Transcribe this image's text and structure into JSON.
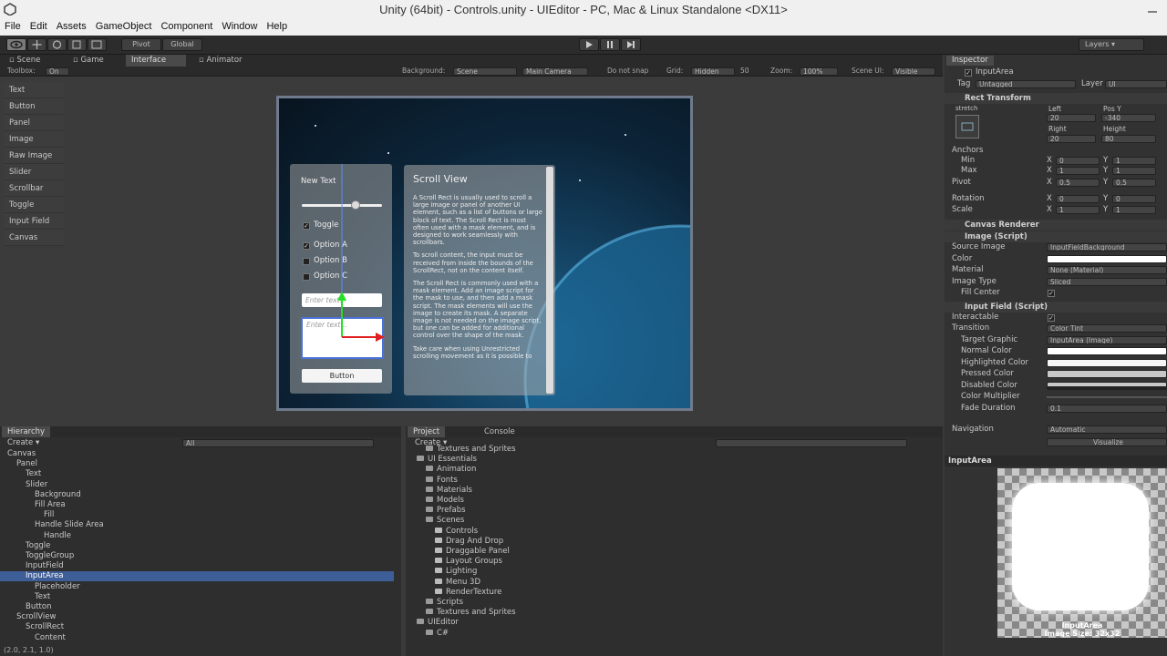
{
  "window": {
    "title": "Unity (64bit) - Controls.unity - UIEditor - PC, Mac & Linux Standalone <DX11>"
  },
  "menu": [
    "File",
    "Edit",
    "Assets",
    "GameObject",
    "Component",
    "Window",
    "Help"
  ],
  "toolbar": {
    "pivot": "Pivot",
    "global": "Global",
    "layers": "Layers"
  },
  "scene_tabs": [
    "Scene",
    "Game",
    "Interface",
    "Animator"
  ],
  "scene_opts": {
    "toolbox_label": "Toolbox:",
    "toolbox_value": "On",
    "background_label": "Background:",
    "background_value": "Scene",
    "camera": "Main Camera",
    "snap": "Do not snap",
    "grid_label": "Grid:",
    "grid_value": "Hidden",
    "grid_num": "50",
    "zoom_label": "Zoom:",
    "zoom_value": "100%",
    "sceneui_label": "Scene UI:",
    "sceneui_value": "Visible"
  },
  "palette": [
    "Text",
    "Button",
    "Panel",
    "Image",
    "Raw Image",
    "Slider",
    "Scrollbar",
    "Toggle",
    "Input Field",
    "Canvas"
  ],
  "canvas_ui": {
    "new_text": "New Text",
    "toggle": "Toggle",
    "options": [
      "Option A",
      "Option B",
      "Option C"
    ],
    "enter_text_1": "Enter text...",
    "enter_text_2": "Enter text...",
    "button": "Button",
    "scroll_title": "Scroll View",
    "scroll_p1": "A Scroll Rect is usually used to scroll a large image or panel of another UI element, such as a list of buttons or large block of text. The Scroll Rect is most often used with a mask element, and is designed to work seamlessly with scrollbars.",
    "scroll_p2": "To scroll content, the input must be received from inside the bounds of the ScrollRect, not on the content itself.",
    "scroll_p3": "The Scroll Rect is commonly used with a mask element. Add an image script for the mask to use, and then add a mask script. The mask elements will use the image to create its mask. A separate image is not needed on the image script, but one can be added for additional control over the shape of the mask.",
    "scroll_p4": "Take care when using Unrestricted scrolling movement as it is possible to"
  },
  "hierarchy": {
    "tab": "Hierarchy",
    "create": "Create",
    "search": "All",
    "items": [
      {
        "label": "Canvas",
        "indent": 0
      },
      {
        "label": "Panel",
        "indent": 1
      },
      {
        "label": "Text",
        "indent": 2
      },
      {
        "label": "Slider",
        "indent": 2
      },
      {
        "label": "Background",
        "indent": 3
      },
      {
        "label": "Fill Area",
        "indent": 3
      },
      {
        "label": "Fill",
        "indent": 4
      },
      {
        "label": "Handle Slide Area",
        "indent": 3
      },
      {
        "label": "Handle",
        "indent": 4
      },
      {
        "label": "Toggle",
        "indent": 2
      },
      {
        "label": "ToggleGroup",
        "indent": 2
      },
      {
        "label": "InputField",
        "indent": 2
      },
      {
        "label": "InputArea",
        "indent": 2,
        "selected": true
      },
      {
        "label": "Placeholder",
        "indent": 3
      },
      {
        "label": "Text",
        "indent": 3
      },
      {
        "label": "Button",
        "indent": 2
      },
      {
        "label": "ScrollView",
        "indent": 1
      },
      {
        "label": "ScrollRect",
        "indent": 2
      },
      {
        "label": "Content",
        "indent": 3
      }
    ]
  },
  "project": {
    "tabs": [
      "Project",
      "Console"
    ],
    "create": "Create",
    "items": [
      {
        "label": "Textures and Sprites",
        "indent": 1
      },
      {
        "label": "UI Essentials",
        "indent": 0
      },
      {
        "label": "Animation",
        "indent": 1
      },
      {
        "label": "Fonts",
        "indent": 1
      },
      {
        "label": "Materials",
        "indent": 1
      },
      {
        "label": "Models",
        "indent": 1
      },
      {
        "label": "Prefabs",
        "indent": 1
      },
      {
        "label": "Scenes",
        "indent": 1
      },
      {
        "label": "Controls",
        "indent": 2
      },
      {
        "label": "Drag And Drop",
        "indent": 2
      },
      {
        "label": "Draggable Panel",
        "indent": 2
      },
      {
        "label": "Layout Groups",
        "indent": 2
      },
      {
        "label": "Lighting",
        "indent": 2
      },
      {
        "label": "Menu 3D",
        "indent": 2
      },
      {
        "label": "RenderTexture",
        "indent": 2
      },
      {
        "label": "Scripts",
        "indent": 1
      },
      {
        "label": "Textures and Sprites",
        "indent": 1
      },
      {
        "label": "UIEditor",
        "indent": 0
      },
      {
        "label": "C#",
        "indent": 1
      }
    ]
  },
  "inspector": {
    "tab": "Inspector",
    "object_name": "InputArea",
    "tag_label": "Tag",
    "tag_value": "Untagged",
    "layer_label": "Layer",
    "layer_value": "UI",
    "rect_transform": "Rect Transform",
    "stretch": "stretch",
    "left_label": "Left",
    "left": "20",
    "posy_label": "Pos Y",
    "posy": "-340",
    "right_label": "Right",
    "right": "20",
    "height_label": "Height",
    "height": "80",
    "anchors": "Anchors",
    "min": "Min",
    "max": "Max",
    "pivot": "Pivot",
    "rotation": "Rotation",
    "scale": "Scale",
    "anchors_min": [
      "0",
      "1"
    ],
    "anchors_max": [
      "1",
      "1"
    ],
    "pivot_v": [
      "0.5",
      "0.5"
    ],
    "rotation_v": [
      "0",
      "0"
    ],
    "scale_v": [
      "1",
      "1"
    ],
    "canvas_renderer": "Canvas Renderer",
    "image_script": "Image (Script)",
    "source_image_label": "Source Image",
    "source_image": "InputFieldBackground",
    "color_label": "Color",
    "material_label": "Material",
    "material": "None (Material)",
    "image_type_label": "Image Type",
    "image_type": "Sliced",
    "fill_center": "Fill Center",
    "input_field": "Input Field (Script)",
    "interactable": "Interactable",
    "transition_label": "Transition",
    "transition": "Color Tint",
    "target_graphic_label": "Target Graphic",
    "target_graphic": "InputArea (Image)",
    "normal": "Normal Color",
    "highlighted": "Highlighted Color",
    "pressed": "Pressed Color",
    "disabled": "Disabled Color",
    "multiplier": "Color Multiplier",
    "fade_label": "Fade Duration",
    "fade": "0.1",
    "navigation_label": "Navigation",
    "navigation": "Automatic",
    "visualize": "Visualize"
  },
  "preview": {
    "title": "InputArea",
    "caption1": "InputArea",
    "caption2": "Image Size: 32x32"
  },
  "status": "(2.0, 2.1, 1.0)"
}
